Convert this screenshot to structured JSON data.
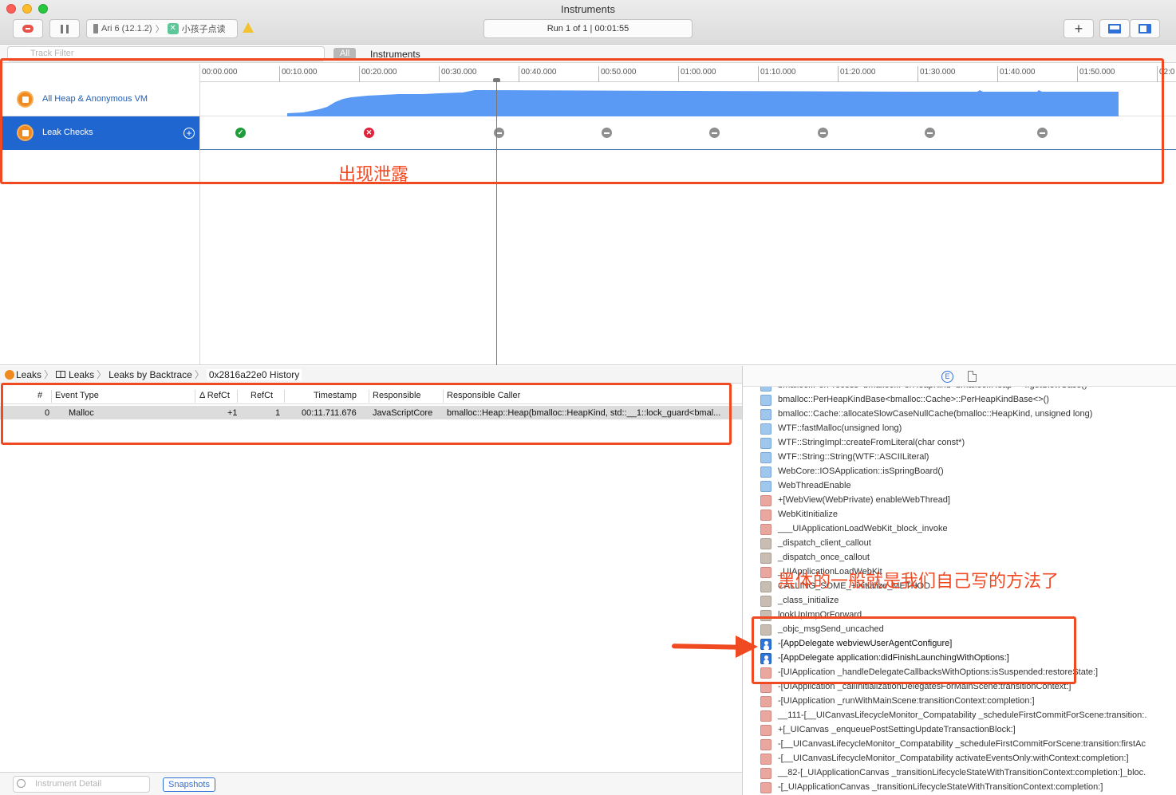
{
  "window": {
    "title": "Instruments"
  },
  "toolbar": {
    "device": "Ari 6 (12.1.2)",
    "app": "小孩子点读",
    "run_status": "Run 1 of 1  |  00:01:55"
  },
  "filterbar": {
    "track_filter_placeholder": "Track Filter",
    "all_label": "All",
    "instruments_label": "Instruments"
  },
  "timeline": {
    "ticks": [
      "00:00.000",
      "00:10.000",
      "00:20.000",
      "00:30.000",
      "00:40.000",
      "00:50.000",
      "01:00.000",
      "01:10.000",
      "01:20.000",
      "01:30.000",
      "01:40.000",
      "01:50.000",
      "02:0"
    ],
    "tracks": [
      {
        "name": "All Heap & Anonymous VM"
      },
      {
        "name": "Leak Checks"
      }
    ],
    "leak_checks": [
      "ok",
      "leak",
      "none",
      "none",
      "none",
      "none",
      "none",
      "none"
    ]
  },
  "annotations": {
    "leak_text": "出现泄露",
    "method_text": "黑体的一般就是我们自己写的方法了"
  },
  "breadcrumb": [
    "Leaks",
    "Leaks",
    "Leaks by Backtrace",
    "0x2816a22e0 History"
  ],
  "table": {
    "headers": [
      "#",
      "Event Type",
      "Δ RefCt",
      "RefCt",
      "Timestamp",
      "Responsible",
      "Responsible Caller"
    ],
    "rows": [
      {
        "num": "0",
        "event": "Malloc",
        "delta": "+1",
        "refct": "1",
        "timestamp": "00:11.711.676",
        "responsible": "JavaScriptCore",
        "caller": "bmalloc::Heap::Heap(bmalloc::HeapKind, std::__1::lock_guard<bmal..."
      }
    ]
  },
  "bottom": {
    "detail_placeholder": "Instrument Detail",
    "snapshots": "Snapshots"
  },
  "inspector": {
    "ext_label": "E",
    "frames": [
      {
        "icon": "lib",
        "text": "bmalloc::PerProcess<bmalloc::PerHeapKind<bmalloc::Heap> >::getSlowCase()"
      },
      {
        "icon": "lib",
        "text": "bmalloc::PerHeapKindBase<bmalloc::Cache>::PerHeapKindBase<>()"
      },
      {
        "icon": "lib",
        "text": "bmalloc::Cache::allocateSlowCaseNullCache(bmalloc::HeapKind, unsigned long)"
      },
      {
        "icon": "lib",
        "text": "WTF::fastMalloc(unsigned long)"
      },
      {
        "icon": "lib",
        "text": "WTF::StringImpl::createFromLiteral(char const*)"
      },
      {
        "icon": "lib",
        "text": "WTF::String::String(WTF::ASCIILiteral)"
      },
      {
        "icon": "lib",
        "text": "WebCore::IOSApplication::isSpringBoard()"
      },
      {
        "icon": "lib",
        "text": "WebThreadEnable"
      },
      {
        "icon": "fw",
        "text": "+[WebView(WebPrivate) enableWebThread]"
      },
      {
        "icon": "fw",
        "text": "WebKitInitialize"
      },
      {
        "icon": "fw",
        "text": "___UIApplicationLoadWebKit_block_invoke"
      },
      {
        "icon": "sys",
        "text": "_dispatch_client_callout"
      },
      {
        "icon": "sys",
        "text": "_dispatch_once_callout"
      },
      {
        "icon": "fw",
        "text": "_UIApplicationLoadWebKit"
      },
      {
        "icon": "sys",
        "text": "CALLING_SOME_+initialize_METHOD"
      },
      {
        "icon": "sys",
        "text": "_class_initialize"
      },
      {
        "icon": "sys",
        "text": "lookUpImpOrForward"
      },
      {
        "icon": "sys",
        "text": "_objc_msgSend_uncached"
      },
      {
        "icon": "user",
        "text": "-[AppDelegate webviewUserAgentConfigure]"
      },
      {
        "icon": "user",
        "text": "-[AppDelegate application:didFinishLaunchingWithOptions:]"
      },
      {
        "icon": "fw",
        "text": "-[UIApplication _handleDelegateCallbacksWithOptions:isSuspended:restoreState:]"
      },
      {
        "icon": "fw",
        "text": "-[UIApplication _callInitializationDelegatesForMainScene:transitionContext:]"
      },
      {
        "icon": "fw",
        "text": "-[UIApplication _runWithMainScene:transitionContext:completion:]"
      },
      {
        "icon": "fw",
        "text": "__111-[__UICanvasLifecycleMonitor_Compatability _scheduleFirstCommitForScene:transition:."
      },
      {
        "icon": "fw",
        "text": "+[_UICanvas _enqueuePostSettingUpdateTransactionBlock:]"
      },
      {
        "icon": "fw",
        "text": "-[__UICanvasLifecycleMonitor_Compatability _scheduleFirstCommitForScene:transition:firstAc"
      },
      {
        "icon": "fw",
        "text": "-[__UICanvasLifecycleMonitor_Compatability activateEventsOnly:withContext:completion:]"
      },
      {
        "icon": "fw",
        "text": "__82-[_UIApplicationCanvas _transitionLifecycleStateWithTransitionContext:completion:]_bloc."
      },
      {
        "icon": "fw",
        "text": "-[_UIApplicationCanvas _transitionLifecycleStateWithTransitionContext:completion:]"
      }
    ]
  }
}
